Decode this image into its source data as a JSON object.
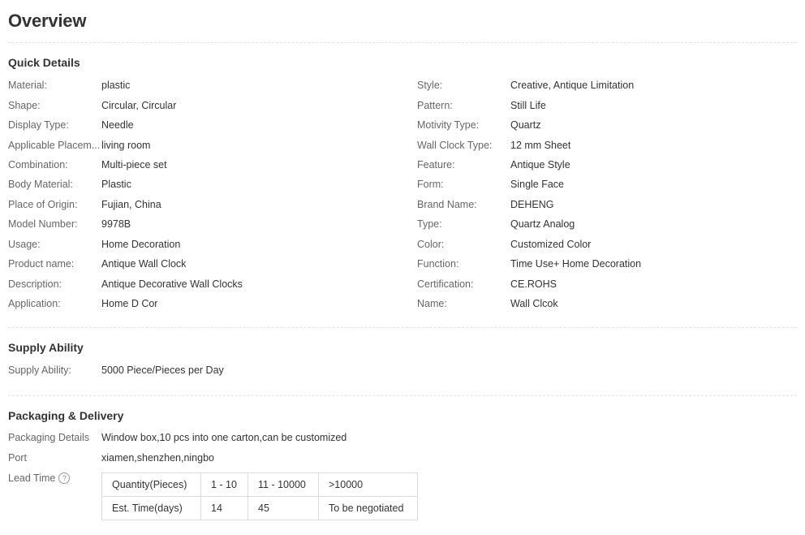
{
  "title": "Overview",
  "quick_details": {
    "heading": "Quick Details",
    "left": [
      {
        "label": "Material:",
        "value": "plastic"
      },
      {
        "label": "Shape:",
        "value": "Circular, Circular"
      },
      {
        "label": "Display Type:",
        "value": "Needle"
      },
      {
        "label": "Applicable Placem...",
        "value": "living room"
      },
      {
        "label": "Combination:",
        "value": "Multi-piece set"
      },
      {
        "label": "Body Material:",
        "value": "Plastic"
      },
      {
        "label": "Place of Origin:",
        "value": "Fujian, China"
      },
      {
        "label": "Model Number:",
        "value": "9978B"
      },
      {
        "label": "Usage:",
        "value": "Home Decoration"
      },
      {
        "label": "Product name:",
        "value": "Antique Wall Clock"
      },
      {
        "label": "Description:",
        "value": "Antique Decorative Wall Clocks"
      },
      {
        "label": "Application:",
        "value": "Home D Cor"
      }
    ],
    "right": [
      {
        "label": "Style:",
        "value": "Creative, Antique Limitation"
      },
      {
        "label": "Pattern:",
        "value": "Still Life"
      },
      {
        "label": "Motivity Type:",
        "value": "Quartz"
      },
      {
        "label": "Wall Clock Type:",
        "value": "12 mm Sheet"
      },
      {
        "label": "Feature:",
        "value": "Antique Style"
      },
      {
        "label": "Form:",
        "value": "Single Face"
      },
      {
        "label": "Brand Name:",
        "value": "DEHENG"
      },
      {
        "label": "Type:",
        "value": "Quartz Analog"
      },
      {
        "label": "Color:",
        "value": "Customized Color"
      },
      {
        "label": "Function:",
        "value": "Time Use+ Home Decoration"
      },
      {
        "label": "Certification:",
        "value": "CE.ROHS"
      },
      {
        "label": "Name:",
        "value": "Wall Clcok"
      }
    ]
  },
  "supply_ability": {
    "heading": "Supply Ability",
    "label": "Supply Ability:",
    "value": "5000 Piece/Pieces per Day"
  },
  "packaging": {
    "heading": "Packaging & Delivery",
    "details_label": "Packaging Details",
    "details_value": "Window box,10 pcs into one carton,can be customized",
    "port_label": "Port",
    "port_value": "xiamen,shenzhen,ningbo",
    "lead_time_label": "Lead Time",
    "help_icon": "question-circle-icon",
    "help_glyph": "?",
    "lead_time_table": {
      "rows": [
        [
          "Quantity(Pieces)",
          "1 - 10",
          "11 - 10000",
          ">10000"
        ],
        [
          "Est. Time(days)",
          "14",
          "45",
          "To be negotiated"
        ]
      ]
    }
  }
}
